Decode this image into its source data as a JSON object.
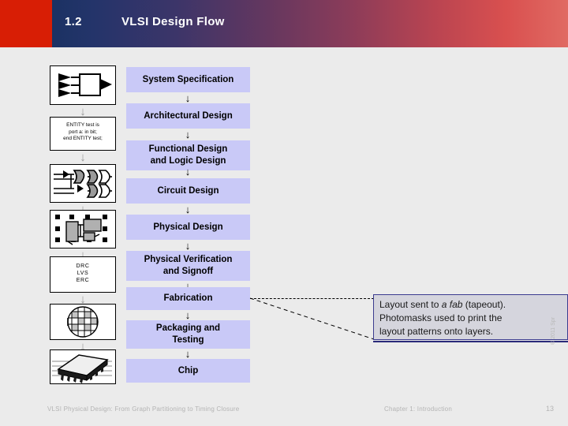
{
  "header": {
    "section_number": "1.2",
    "title": "VLSI Design Flow",
    "accent_red": "#d81e05",
    "gradient_start": "#1b3263",
    "gradient_end": "#e06a63"
  },
  "flow": {
    "box_color": "#c9c9f7",
    "arrow_glyph": "↓",
    "steps": [
      {
        "label": "System Specification"
      },
      {
        "label": "Architectural Design"
      },
      {
        "label": "Functional Design\nand Logic Design"
      },
      {
        "label": "Circuit Design"
      },
      {
        "label": "Physical Design"
      },
      {
        "label": "Physical Verification\nand Signoff"
      },
      {
        "label": "Fabrication"
      },
      {
        "label": "Packaging and\nTesting"
      },
      {
        "label": "Chip"
      }
    ]
  },
  "icons": {
    "arrow_glyph": "↓",
    "items": [
      {
        "name": "block-diagram-icon",
        "caption": ""
      },
      {
        "name": "vhdl-code-icon",
        "caption": "ENTITY test is\nport a: in bit;\nend ENTITY test;"
      },
      {
        "name": "logic-gates-icon",
        "caption": ""
      },
      {
        "name": "floorplan-layout-icon",
        "caption": ""
      },
      {
        "name": "verification-checks-icon",
        "caption": "DRC\nLVS\nERC"
      },
      {
        "name": "wafer-icon",
        "caption": ""
      },
      {
        "name": "chip-package-icon",
        "caption": ""
      }
    ],
    "vhdl_lines": [
      "ENTITY test is",
      "port a: in bit;",
      "end ENTITY test;"
    ],
    "drc_lines": [
      "DRC",
      "LVS",
      "ERC"
    ]
  },
  "callout": {
    "line1_prefix": "Layout sent to ",
    "line1_italic": "a fab",
    "line1_suffix": " (tapeout).",
    "line2": "Photomasks used to print the",
    "line3": "layout patterns onto layers.",
    "border_color": "#3b3b8f",
    "background": "#d5d5dd"
  },
  "copyright": "© 2011 Spr",
  "footer": {
    "left": "VLSI Physical Design: From Graph Partitioning to Timing Closure",
    "center": "Chapter 1: Introduction",
    "page": "13"
  }
}
